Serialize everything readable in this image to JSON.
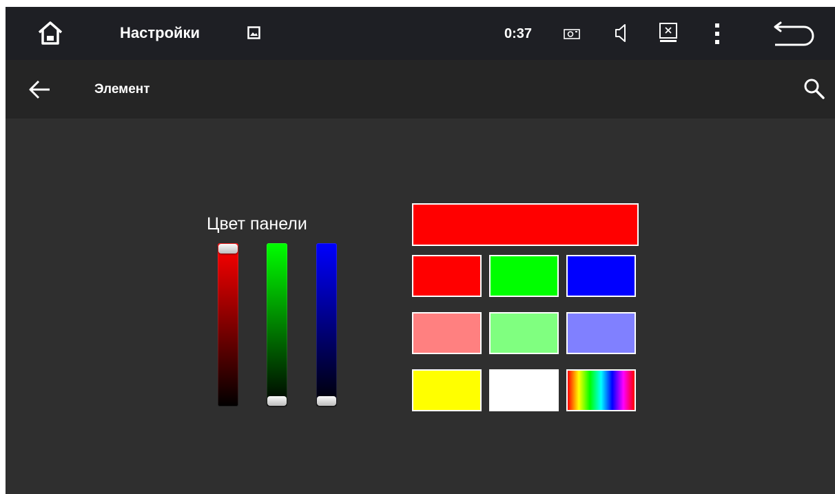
{
  "statusbar": {
    "title": "Настройки",
    "time": "0:37",
    "icons": [
      "home-icon",
      "image-icon",
      "camera-icon",
      "volume-icon",
      "screen-off-icon",
      "more-vert-icon",
      "back-arrow-icon"
    ]
  },
  "appbar": {
    "title": "Элемент",
    "icons": [
      "arrow-left-icon",
      "search-icon"
    ]
  },
  "panel": {
    "label": "Цвет панели",
    "preview_color": "#ff0000",
    "sliders": [
      {
        "name": "red",
        "level": 1.0,
        "top_color": "#ff0000"
      },
      {
        "name": "green",
        "level": 0.0,
        "top_color": "#00ff00"
      },
      {
        "name": "blue",
        "level": 0.0,
        "top_color": "#0000ff"
      }
    ],
    "swatches": [
      "#ff0000",
      "#00ff00",
      "#0000ff",
      "#ff8080",
      "#80ff80",
      "#8080ff",
      "#ffff00",
      "#ffffff",
      "rainbow"
    ]
  }
}
